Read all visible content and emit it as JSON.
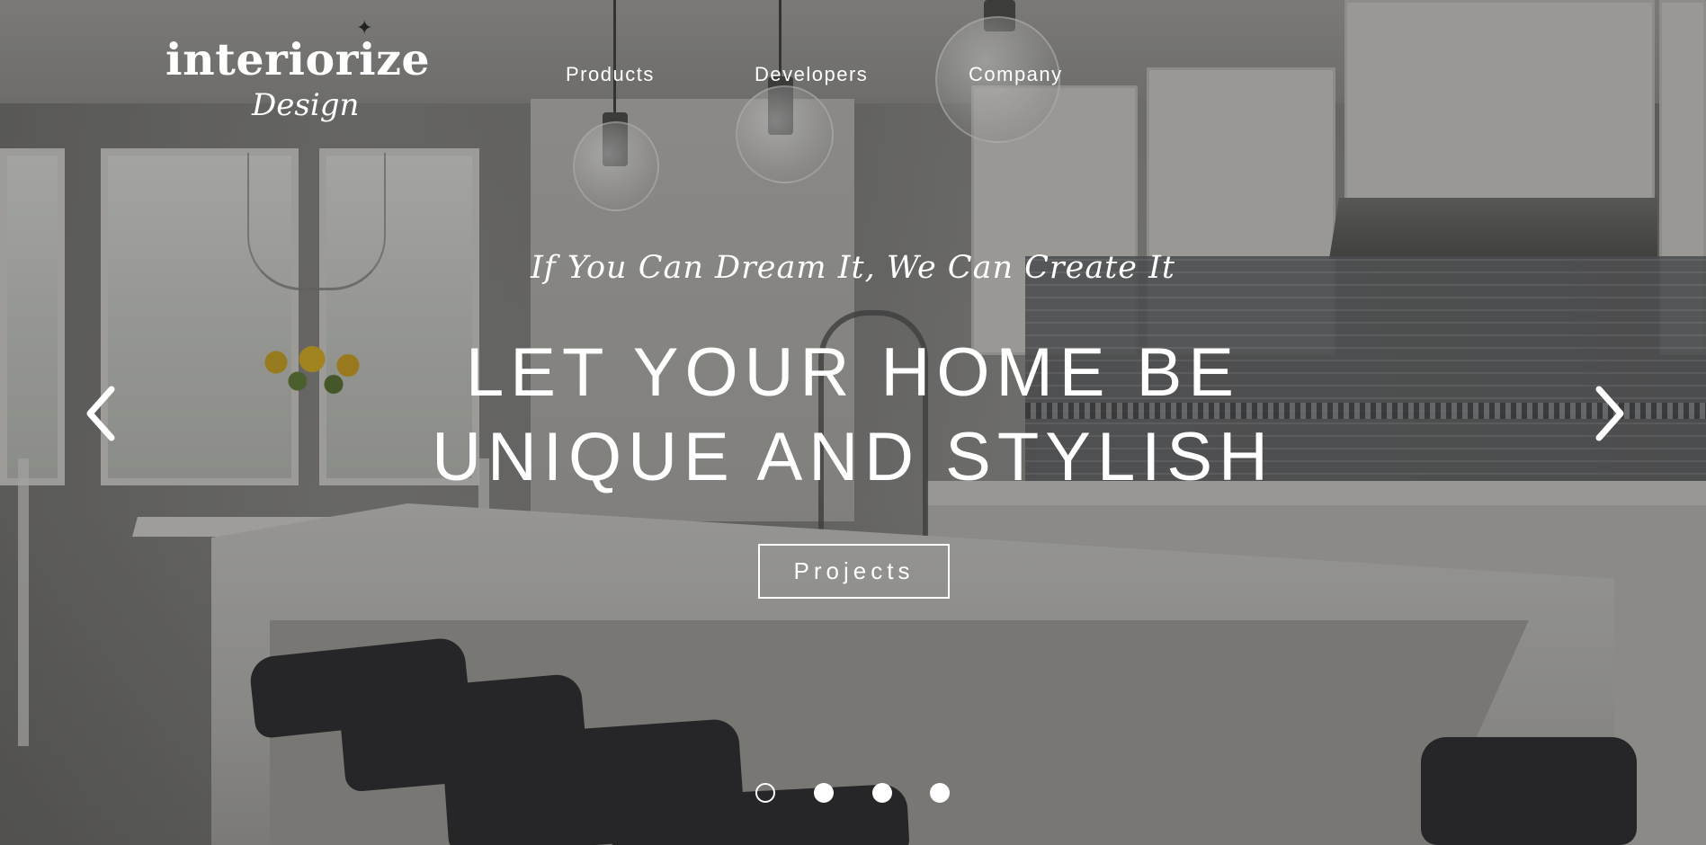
{
  "brand": {
    "logo_main": "interiorize",
    "logo_sub": "Design",
    "logo_sparkle": "✦"
  },
  "nav": {
    "items": [
      {
        "label": "Products"
      },
      {
        "label": "Developers"
      },
      {
        "label": "Company"
      }
    ]
  },
  "hero": {
    "tagline": "If You Can Dream It, We Can Create It",
    "headline_line1": "LET YOUR HOME BE",
    "headline_line2": "UNIQUE AND STYLISH",
    "cta_label": "Projects",
    "background_image": "kitchen interior photo"
  },
  "carousel": {
    "prev_icon": "chevron-left-icon",
    "next_icon": "chevron-right-icon",
    "slide_count": 4,
    "active_slide": 1
  },
  "colors": {
    "text": "#ffffff",
    "overlay": "#191919"
  }
}
